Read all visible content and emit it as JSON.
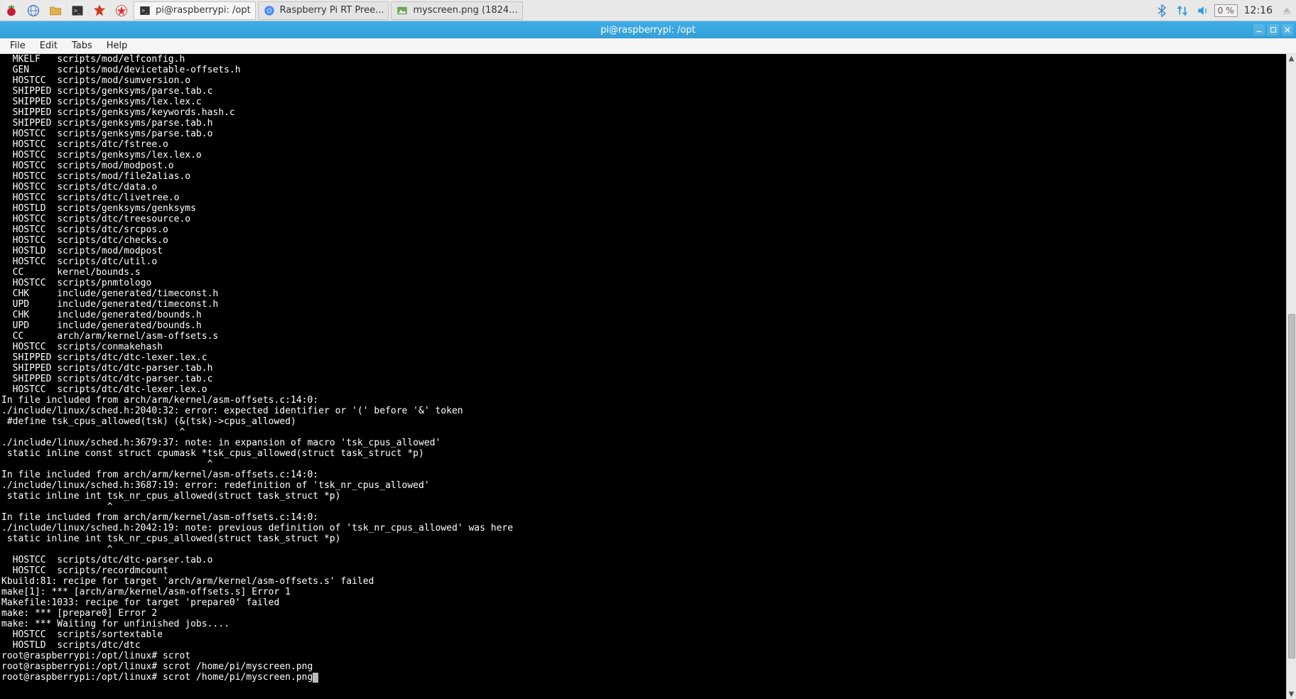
{
  "panel": {
    "launchers": [
      {
        "name": "menu-icon",
        "glyph": "raspberry"
      },
      {
        "name": "web-icon",
        "glyph": "globe"
      },
      {
        "name": "files-icon",
        "glyph": "folder"
      },
      {
        "name": "terminal-icon",
        "glyph": "terminal"
      },
      {
        "name": "mathematica-icon",
        "glyph": "spiky-red"
      },
      {
        "name": "wolfram-icon",
        "glyph": "wolfram-red"
      }
    ],
    "tasks": [
      {
        "icon": "terminal",
        "label": "pi@raspberrypi: /opt",
        "active": true
      },
      {
        "icon": "chromium",
        "label": "Raspberry Pi RT Pree...",
        "active": false
      },
      {
        "icon": "image",
        "label": "myscreen.png (1824...",
        "active": false
      }
    ],
    "tray": {
      "bluetooth": "bluetooth-icon",
      "network": "network-updown-icon",
      "volume": "volume-icon",
      "cpu": "0 %",
      "clock": "12:16"
    }
  },
  "window": {
    "title": "pi@raspberrypi: /opt",
    "menubar": [
      "File",
      "Edit",
      "Tabs",
      "Help"
    ]
  },
  "terminal": {
    "lines": [
      "  MKELF   scripts/mod/elfconfig.h",
      "  GEN     scripts/mod/devicetable-offsets.h",
      "  HOSTCC  scripts/mod/sumversion.o",
      "  SHIPPED scripts/genksyms/parse.tab.c",
      "  SHIPPED scripts/genksyms/lex.lex.c",
      "  SHIPPED scripts/genksyms/keywords.hash.c",
      "  SHIPPED scripts/genksyms/parse.tab.h",
      "  HOSTCC  scripts/genksyms/parse.tab.o",
      "  HOSTCC  scripts/dtc/fstree.o",
      "  HOSTCC  scripts/genksyms/lex.lex.o",
      "  HOSTCC  scripts/mod/modpost.o",
      "  HOSTCC  scripts/mod/file2alias.o",
      "  HOSTCC  scripts/dtc/data.o",
      "  HOSTCC  scripts/dtc/livetree.o",
      "  HOSTLD  scripts/genksyms/genksyms",
      "  HOSTCC  scripts/dtc/treesource.o",
      "  HOSTCC  scripts/dtc/srcpos.o",
      "  HOSTCC  scripts/dtc/checks.o",
      "  HOSTLD  scripts/mod/modpost",
      "  HOSTCC  scripts/dtc/util.o",
      "  CC      kernel/bounds.s",
      "  HOSTCC  scripts/pnmtologo",
      "  CHK     include/generated/timeconst.h",
      "  UPD     include/generated/timeconst.h",
      "  CHK     include/generated/bounds.h",
      "  UPD     include/generated/bounds.h",
      "  CC      arch/arm/kernel/asm-offsets.s",
      "  HOSTCC  scripts/conmakehash",
      "  SHIPPED scripts/dtc/dtc-lexer.lex.c",
      "  SHIPPED scripts/dtc/dtc-parser.tab.h",
      "  SHIPPED scripts/dtc/dtc-parser.tab.c",
      "  HOSTCC  scripts/dtc/dtc-lexer.lex.o",
      "In file included from arch/arm/kernel/asm-offsets.c:14:0:",
      "./include/linux/sched.h:2040:32: error: expected identifier or '(' before '&' token",
      " #define tsk_cpus_allowed(tsk) (&(tsk)->cpus_allowed)",
      "                                ^",
      "./include/linux/sched.h:3679:37: note: in expansion of macro 'tsk_cpus_allowed'",
      " static inline const struct cpumask *tsk_cpus_allowed(struct task_struct *p)",
      "                                     ^",
      "In file included from arch/arm/kernel/asm-offsets.c:14:0:",
      "./include/linux/sched.h:3687:19: error: redefinition of 'tsk_nr_cpus_allowed'",
      " static inline int tsk_nr_cpus_allowed(struct task_struct *p)",
      "                   ^",
      "In file included from arch/arm/kernel/asm-offsets.c:14:0:",
      "./include/linux/sched.h:2042:19: note: previous definition of 'tsk_nr_cpus_allowed' was here",
      " static inline int tsk_nr_cpus_allowed(struct task_struct *p)",
      "                   ^",
      "  HOSTCC  scripts/dtc/dtc-parser.tab.o",
      "  HOSTCC  scripts/recordmcount",
      "Kbuild:81: recipe for target 'arch/arm/kernel/asm-offsets.s' failed",
      "make[1]: *** [arch/arm/kernel/asm-offsets.s] Error 1",
      "Makefile:1033: recipe for target 'prepare0' failed",
      "make: *** [prepare0] Error 2",
      "make: *** Waiting for unfinished jobs....",
      "  HOSTCC  scripts/sortextable",
      "  HOSTLD  scripts/dtc/dtc",
      "root@raspberrypi:/opt/linux# scrot",
      "root@raspberrypi:/opt/linux# scrot /home/pi/myscreen.png",
      "root@raspberrypi:/opt/linux# scrot /home/pi/myscreen.png"
    ]
  }
}
